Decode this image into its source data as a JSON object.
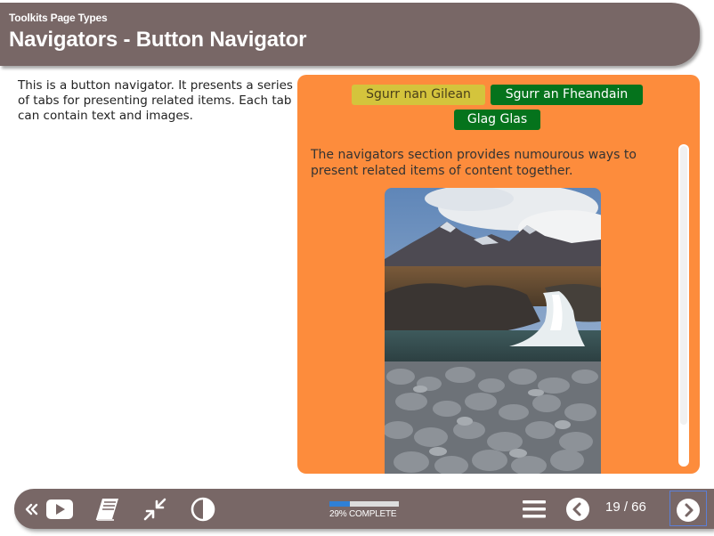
{
  "header": {
    "subtitle": "Toolkits Page Types",
    "title": "Navigators - Button Navigator"
  },
  "intro": {
    "text": "This is a button navigator. It presents a series of tabs for presenting related items. Each tab can contain text and images."
  },
  "navigator": {
    "tabs": [
      {
        "label": "Sgurr nan Gilean",
        "state": "selected"
      },
      {
        "label": "Sgurr an Fheandain",
        "state": "default"
      },
      {
        "label": "Glag Glas",
        "state": "default"
      }
    ],
    "content_text": "The navigators section provides numourous ways to present related items of content together.",
    "image": "mountain-waterfall-photo"
  },
  "footer": {
    "icons": [
      "double-chevron-left-icon",
      "play-video-icon",
      "book-icon",
      "compress-icon",
      "contrast-icon",
      "menu-icon",
      "chevron-left-icon",
      "chevron-right-icon"
    ],
    "progress_percent": 29,
    "progress_label": "29% COMPLETE",
    "page_counter": "19 / 66"
  },
  "colors": {
    "header_bg": "#786766",
    "panel_bg": "#fd8c3c",
    "tab_selected_bg": "#d4c43c",
    "tab_default_bg": "#05731c",
    "progress_fill": "#2f80d6"
  }
}
